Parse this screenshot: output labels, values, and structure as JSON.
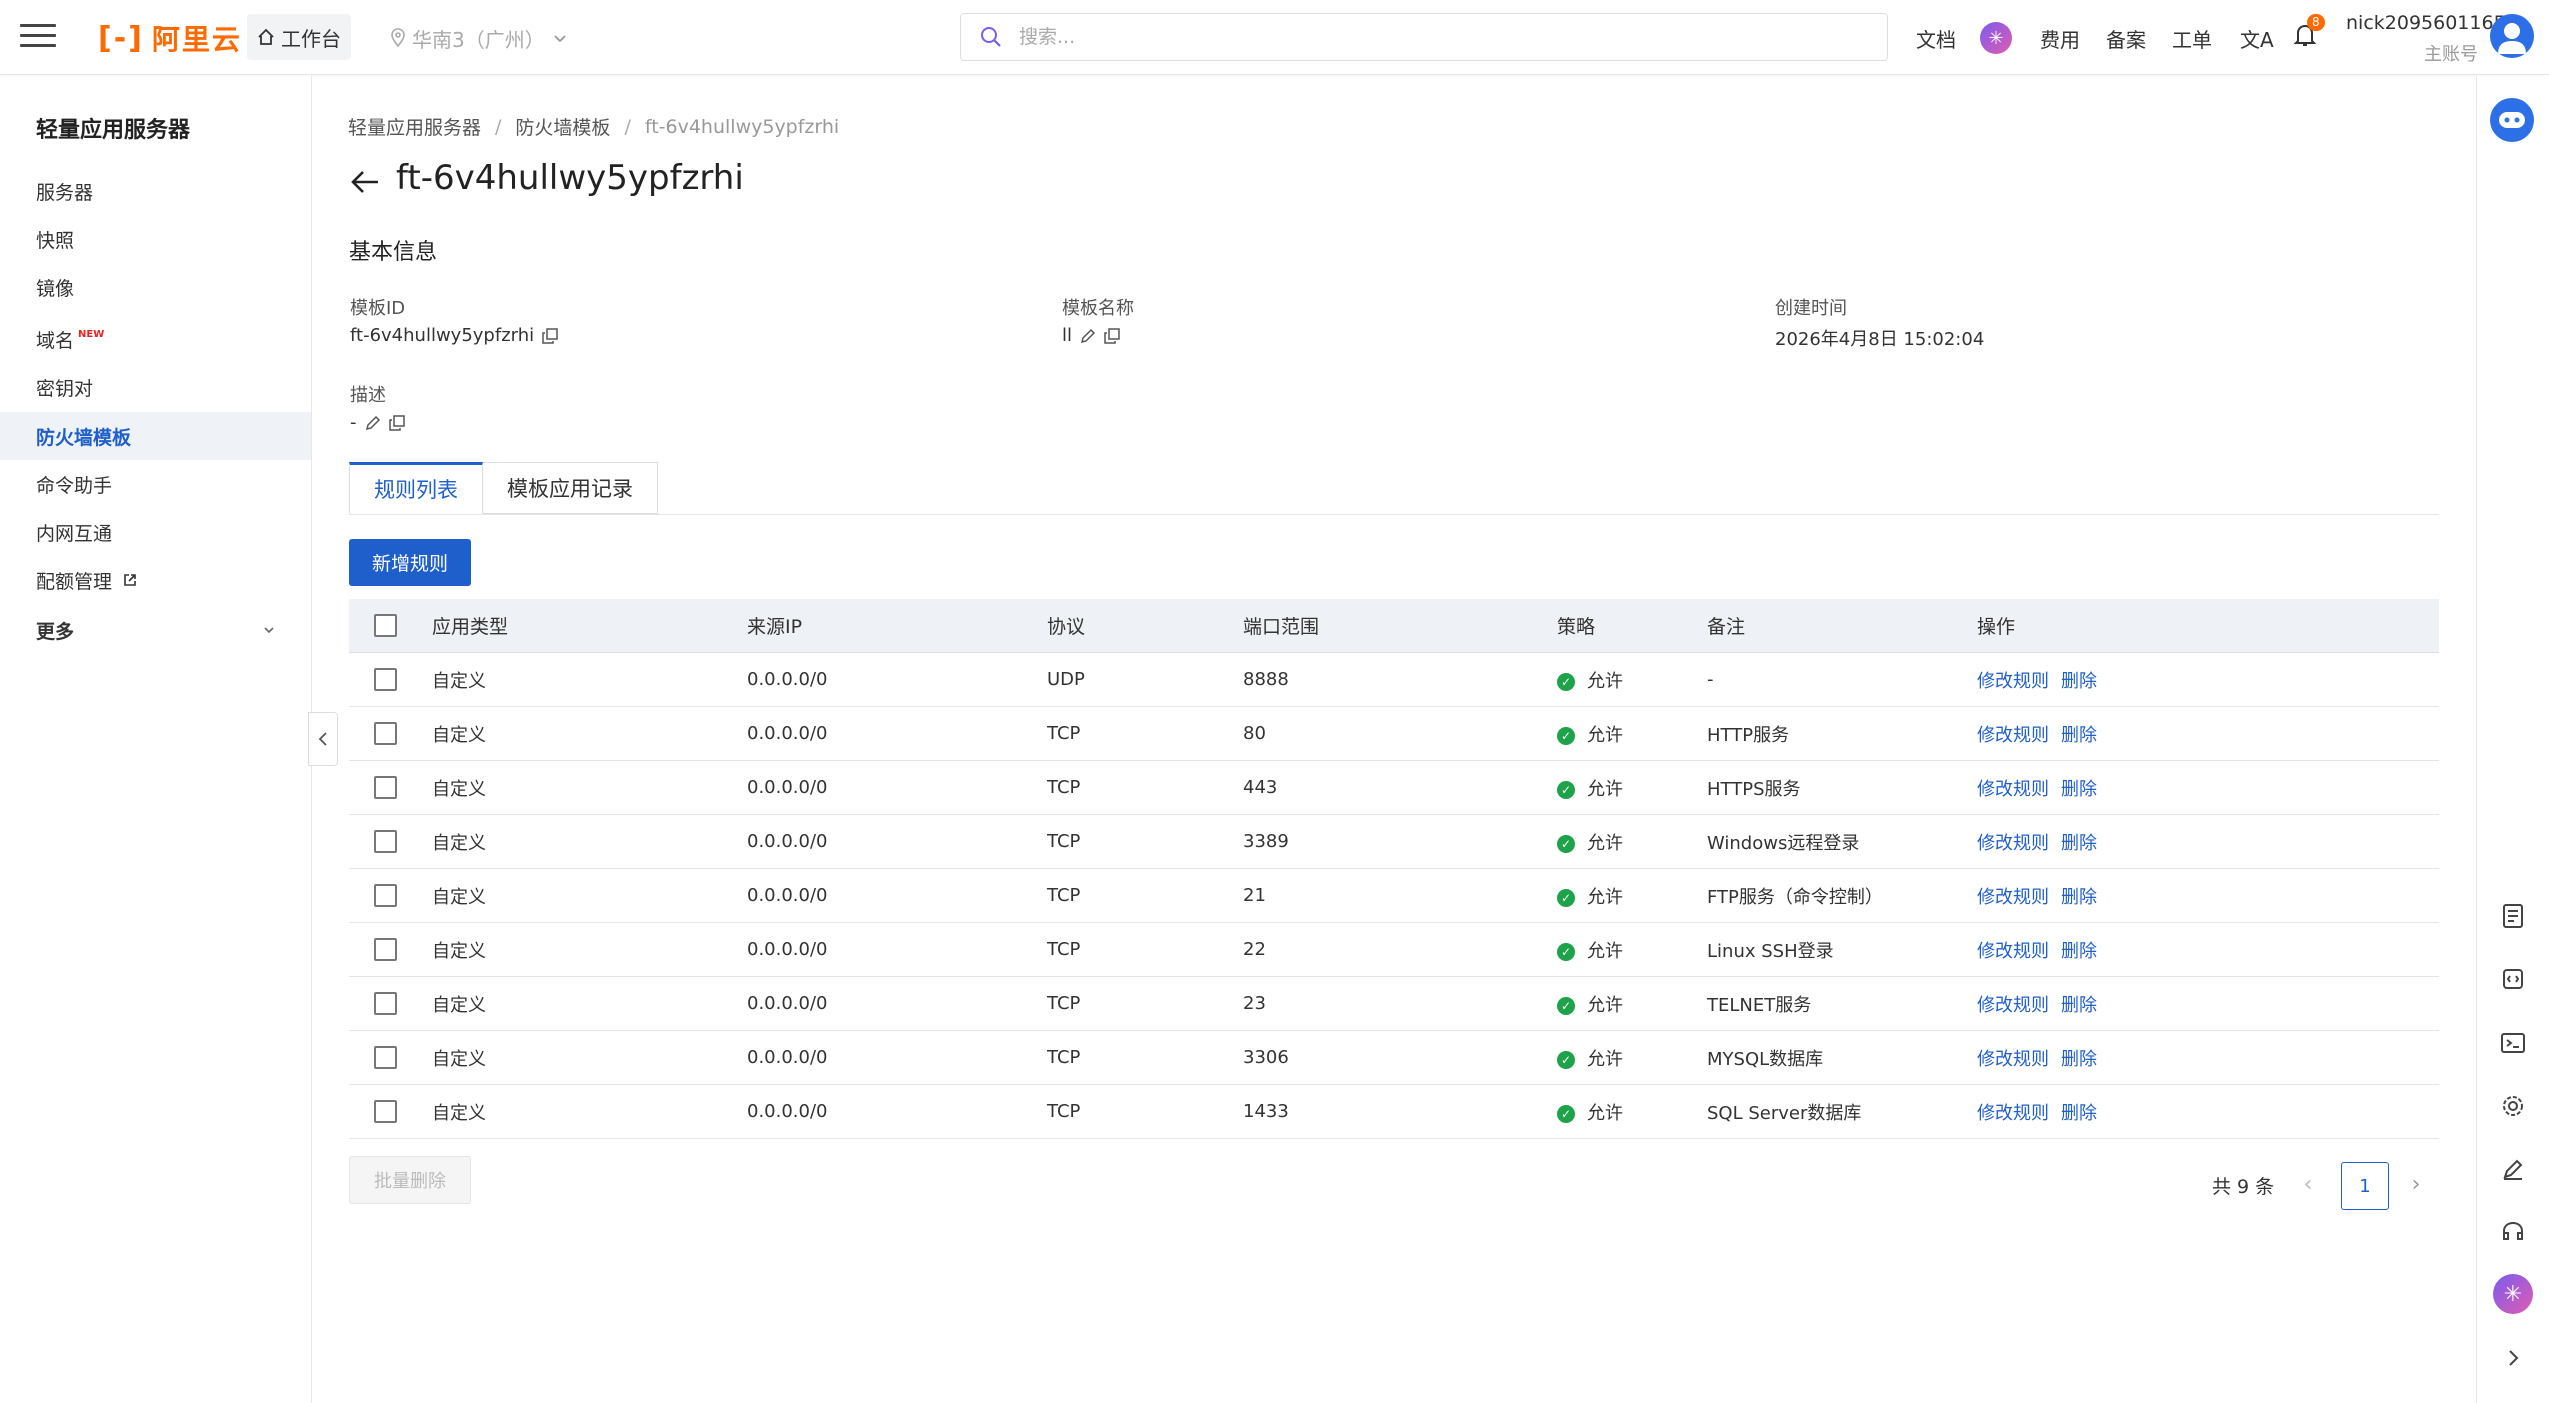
{
  "topbar": {
    "logo_text": "阿里云",
    "workbench": "工作台",
    "region": "华南3（广州）",
    "search_placeholder": "搜索...",
    "nav": [
      "文档",
      "费用",
      "备案",
      "工单"
    ],
    "notification_count": "8",
    "user_name": "nick2095601165",
    "user_role": "主账号"
  },
  "sidebar": {
    "title": "轻量应用服务器",
    "items": [
      {
        "label": "服务器"
      },
      {
        "label": "快照"
      },
      {
        "label": "镜像"
      },
      {
        "label": "域名",
        "badge": "NEW"
      },
      {
        "label": "密钥对"
      },
      {
        "label": "防火墙模板",
        "active": true
      },
      {
        "label": "命令助手"
      },
      {
        "label": "内网互通"
      },
      {
        "label": "配额管理"
      }
    ],
    "more": "更多"
  },
  "breadcrumb": [
    "轻量应用服务器",
    "防火墙模板",
    "ft-6v4hullwy5ypfzrhi"
  ],
  "page_title": "ft-6v4hullwy5ypfzrhi",
  "basic_info": {
    "title": "基本信息",
    "template_id_label": "模板ID",
    "template_id": "ft-6v4hullwy5ypfzrhi",
    "template_name_label": "模板名称",
    "template_name": "ll",
    "created_label": "创建时间",
    "created": "2026年4月8日 15:02:04",
    "desc_label": "描述",
    "desc": "-"
  },
  "tabs": [
    "规则列表",
    "模板应用记录"
  ],
  "add_rule_button": "新增规则",
  "table": {
    "headers": [
      "应用类型",
      "来源IP",
      "协议",
      "端口范围",
      "策略",
      "备注",
      "操作"
    ],
    "rows": [
      {
        "type": "自定义",
        "ip": "0.0.0.0/0",
        "proto": "UDP",
        "port": "8888",
        "policy": "允许",
        "note": "-"
      },
      {
        "type": "自定义",
        "ip": "0.0.0.0/0",
        "proto": "TCP",
        "port": "80",
        "policy": "允许",
        "note": "HTTP服务"
      },
      {
        "type": "自定义",
        "ip": "0.0.0.0/0",
        "proto": "TCP",
        "port": "443",
        "policy": "允许",
        "note": "HTTPS服务"
      },
      {
        "type": "自定义",
        "ip": "0.0.0.0/0",
        "proto": "TCP",
        "port": "3389",
        "policy": "允许",
        "note": "Windows远程登录"
      },
      {
        "type": "自定义",
        "ip": "0.0.0.0/0",
        "proto": "TCP",
        "port": "21",
        "policy": "允许",
        "note": "FTP服务（命令控制）"
      },
      {
        "type": "自定义",
        "ip": "0.0.0.0/0",
        "proto": "TCP",
        "port": "22",
        "policy": "允许",
        "note": "Linux SSH登录"
      },
      {
        "type": "自定义",
        "ip": "0.0.0.0/0",
        "proto": "TCP",
        "port": "23",
        "policy": "允许",
        "note": "TELNET服务"
      },
      {
        "type": "自定义",
        "ip": "0.0.0.0/0",
        "proto": "TCP",
        "port": "3306",
        "policy": "允许",
        "note": "MYSQL数据库"
      },
      {
        "type": "自定义",
        "ip": "0.0.0.0/0",
        "proto": "TCP",
        "port": "1433",
        "policy": "允许",
        "note": "SQL Server数据库"
      }
    ],
    "edit_label": "修改规则",
    "delete_label": "删除"
  },
  "batch_delete_button": "批量删除",
  "pagination": {
    "total": "共 9 条",
    "page": "1"
  },
  "colors": {
    "primary": "#1f5fcc",
    "brand": "#ff6a00",
    "success": "#1ea34a"
  }
}
